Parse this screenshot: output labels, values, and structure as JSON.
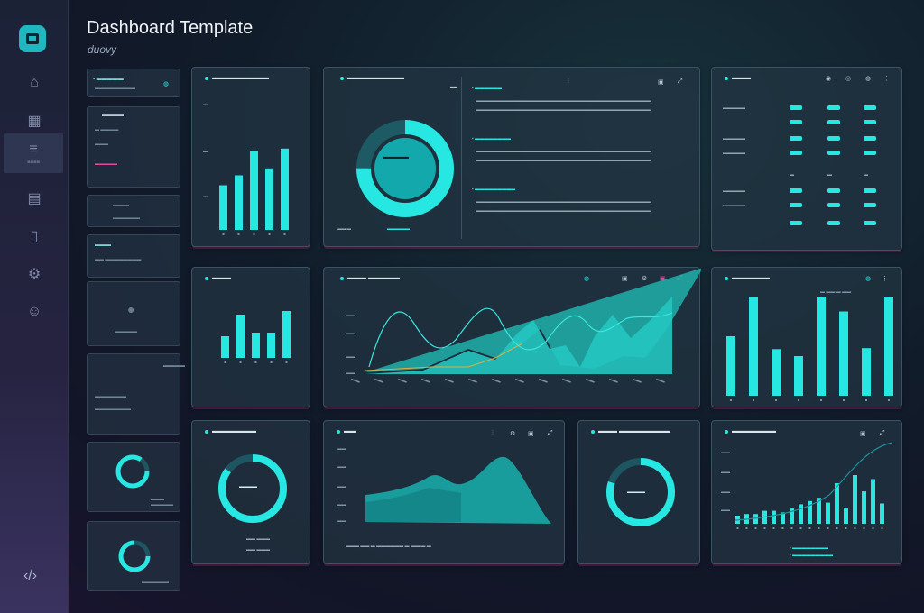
{
  "app": {
    "title": "Dashboard Template",
    "subtitle": "duovy"
  },
  "colors": {
    "accent": "#26e7e2",
    "accent_dark": "#1a9ea3",
    "panel": "#223442",
    "magenta_glow": "#aa2878",
    "sidebar_top": "#1b2236",
    "sidebar_bottom": "#3a3360"
  },
  "sidebar": {
    "items": [
      {
        "icon": "home-icon",
        "glyph": "⌂"
      },
      {
        "icon": "grid-icon",
        "glyph": "▦"
      },
      {
        "icon": "analytics-icon",
        "glyph": "≡",
        "label": "≡≡≡≡",
        "active": true
      },
      {
        "icon": "folder-icon",
        "glyph": "▤"
      },
      {
        "icon": "document-icon",
        "glyph": "▯"
      },
      {
        "icon": "settings-icon",
        "glyph": "⚙"
      },
      {
        "icon": "user-icon",
        "glyph": "☺"
      }
    ],
    "bottom_icon": "code-icon"
  },
  "thumbnails": [
    {
      "title": "▪ ▬▬▬▬▬",
      "lines": [
        "▬▬▬▬▬▬▬▬▬"
      ]
    },
    {
      "title": "▬▬▬▬",
      "lines": [
        "▬ ▬▬▬▬",
        "▬▬▬",
        "▬▬▬▬▬"
      ]
    },
    {
      "title": "▬▬▬",
      "lines": [
        "▬▬▬▬▬▬"
      ]
    },
    {
      "title": "▬▬▬",
      "lines": [
        "▬▬ ▬▬▬▬▬▬▬▬"
      ]
    },
    {
      "title": "",
      "lines": [
        "▬▬▬▬▬"
      ]
    },
    {
      "title": "▬▬▬▬",
      "lines": [
        "▬▬▬▬▬▬▬",
        "▬▬▬▬▬▬▬▬"
      ]
    },
    {
      "title": "",
      "lines": [
        "▬▬▬ ▬▬▬▬▬"
      ]
    },
    {
      "title": "",
      "lines": [
        "▬▬▬▬▬▬"
      ]
    }
  ],
  "panels": {
    "bar_top": {
      "title": "▬▬▬▬▬▬▬▬▬",
      "bars": [
        0.45,
        0.55,
        0.8,
        0.62,
        0.82
      ]
    },
    "donut_panel": {
      "title": "▬▬▬▬▬▬▬▬▬",
      "center": "▬▬▬▬",
      "donut_fraction": 0.75,
      "sections": [
        {
          "heading": "▬▬▬▬▬▬",
          "lines": [
            "▬▬▬▬▬▬▬▬▬▬▬▬▬▬▬▬▬▬▬▬▬▬▬▬▬▬▬▬▬▬▬▬▬▬▬▬▬▬▬",
            "▬▬▬▬▬▬▬▬▬▬▬▬▬▬▬▬▬▬▬▬▬▬▬▬▬▬▬▬▬▬▬▬▬▬▬▬▬▬▬"
          ]
        },
        {
          "heading": "▬▬▬▬▬▬▬▬",
          "lines": [
            "▬▬▬▬▬▬▬▬▬▬▬▬▬▬▬▬▬▬▬▬▬▬▬▬▬▬▬▬▬▬▬▬▬▬▬▬▬▬▬",
            "▬▬▬▬▬▬▬▬▬▬▬▬▬▬▬▬▬▬▬▬▬▬▬▬▬▬▬▬▬▬▬▬▬▬▬▬▬▬▬"
          ]
        },
        {
          "heading": "▬▬▬▬▬▬▬▬▬",
          "lines": [
            "▬▬▬▬▬▬▬▬▬▬▬▬▬▬▬▬▬▬▬▬▬▬▬▬▬▬▬▬▬▬▬▬▬▬▬▬▬▬▬",
            "▬▬▬▬▬▬▬▬▬▬▬▬▬▬▬▬▬▬▬▬▬▬▬▬▬▬▬▬▬▬▬▬▬▬▬▬▬▬▬"
          ]
        }
      ]
    },
    "table_panel": {
      "title": "▬▬▬"
    },
    "bar_mid": {
      "title": "▬▬▬",
      "bars": [
        0.3,
        0.6,
        0.35,
        0.35,
        0.65
      ]
    },
    "line_panel": {
      "title": "▬▬▬ ▬▬▬▬▬"
    },
    "bar_right": {
      "title": "▬▬▬▬▬▬",
      "bars": [
        0.6,
        1.0,
        0.47,
        0.4,
        1.0,
        0.85,
        0.48,
        1.0
      ]
    },
    "ring_left": {
      "title": "▬▬▬▬▬▬▬",
      "center": "▬▬▬▬",
      "fraction": 0.85
    },
    "area_panel": {
      "title": "▬▬"
    },
    "ring_mid": {
      "title": "▬▬▬ ▬▬▬▬▬▬▬▬",
      "center": "▬▬▬▬",
      "fraction": 0.8
    },
    "combo_panel": {
      "title": "▬▬▬▬▬▬▬",
      "bars": [
        0.1,
        0.12,
        0.12,
        0.16,
        0.16,
        0.14,
        0.2,
        0.24,
        0.28,
        0.32,
        0.26,
        0.5,
        0.2,
        0.6,
        0.4,
        0.55,
        0.25
      ]
    }
  }
}
